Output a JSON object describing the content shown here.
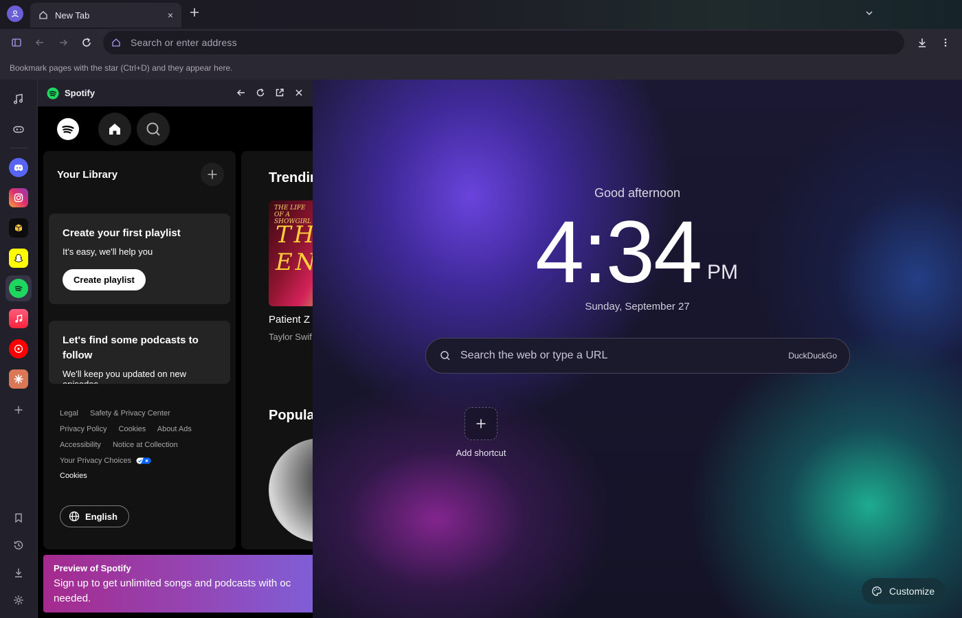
{
  "tab": {
    "title": "New Tab",
    "close": "×"
  },
  "toolbar": {
    "address_placeholder": "Search or enter address"
  },
  "bookmarks": {
    "hint": "Bookmark pages with the star (Ctrl+D) and they appear here."
  },
  "sidebar": {
    "items": [
      {
        "name": "music",
        "icon": "music-note-icon"
      },
      {
        "name": "games",
        "icon": "gamepad-icon"
      },
      {
        "name": "discord",
        "icon": "discord-icon",
        "color": "#5865f2"
      },
      {
        "name": "instagram",
        "icon": "instagram-icon",
        "color": "#e1306c"
      },
      {
        "name": "app",
        "icon": "cube-icon",
        "color": "#0d0d0d"
      },
      {
        "name": "snapchat",
        "icon": "snapchat-icon",
        "color": "#fffc00"
      },
      {
        "name": "spotify",
        "icon": "spotify-icon",
        "color": "#1ed760",
        "active": true
      },
      {
        "name": "apple-music",
        "icon": "apple-music-icon",
        "color": "#fa2d48"
      },
      {
        "name": "youtube-music",
        "icon": "youtube-music-icon",
        "color": "#ff0000"
      },
      {
        "name": "claude",
        "icon": "sparkle-icon",
        "color": "#d97757"
      }
    ]
  },
  "panel": {
    "title": "Spotify",
    "library": {
      "title": "Your Library",
      "playlist_card": {
        "title": "Create your first playlist",
        "subtitle": "It's easy, we'll help you",
        "button": "Create playlist"
      },
      "podcast_card": {
        "title": "Let's find some podcasts to follow",
        "subtitle": "We'll keep you updated on new episodes"
      },
      "legal_links": [
        "Legal",
        "Safety & Privacy Center",
        "Privacy Policy",
        "Cookies",
        "About Ads",
        "Accessibility",
        "Notice at Collection",
        "Your Privacy Choices"
      ],
      "cookies": "Cookies",
      "language": "English"
    },
    "trending": {
      "heading": "Trendir",
      "song": "Patient Z",
      "artist": "Taylor Swif"
    },
    "popular": {
      "heading": "Popula"
    },
    "preview": {
      "title": "Preview of Spotify",
      "text_line1": "Sign up to get unlimited songs and podcasts with oc",
      "text_line2": "needed."
    }
  },
  "ntp": {
    "greeting": "Good afternoon",
    "time": "4:34",
    "ampm": "PM",
    "date": "Sunday, September 27",
    "search_placeholder": "Search the web or type a URL",
    "search_engine": "DuckDuckGo",
    "shortcut_label": "Add shortcut",
    "customize": "Customize"
  }
}
